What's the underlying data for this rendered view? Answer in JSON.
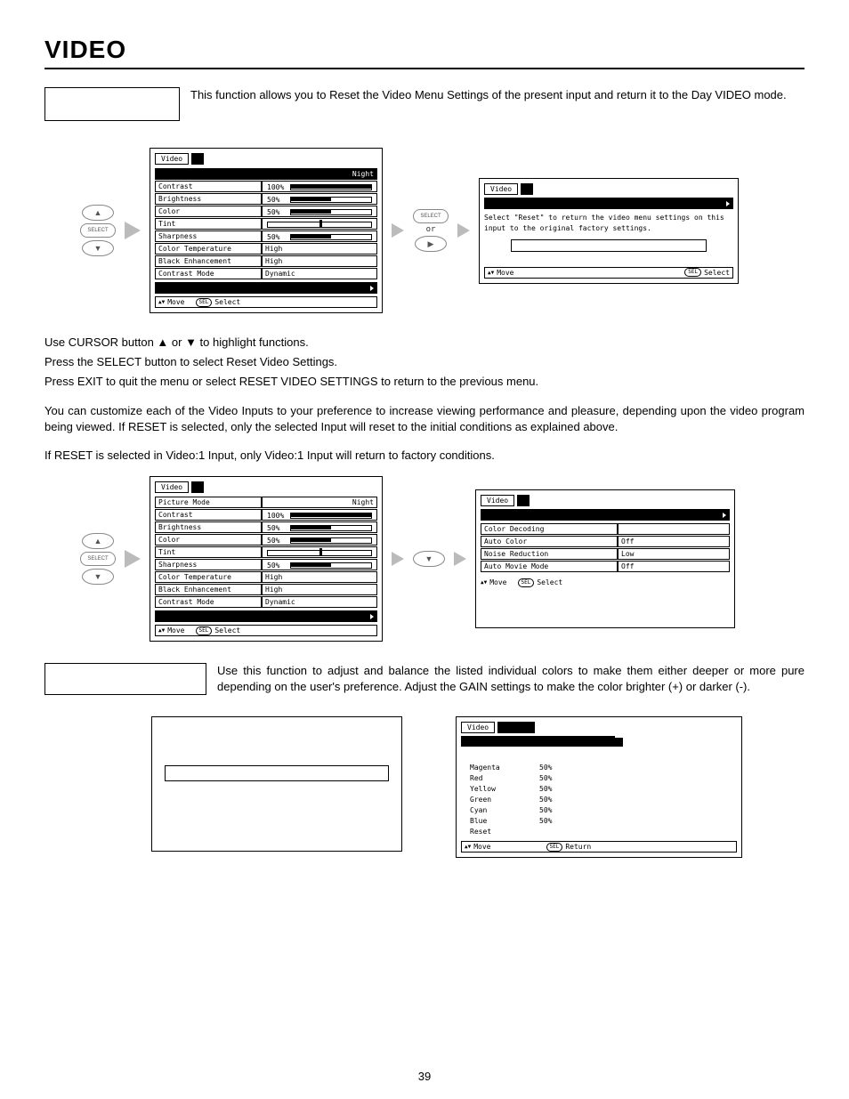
{
  "page": {
    "title": "VIDEO",
    "number": "39"
  },
  "section1": {
    "desc": "This function allows you to Reset the Video Menu Settings of the present input and return it to the Day VIDEO mode."
  },
  "osd_video_label": "Video",
  "remote": {
    "select_label": "SELECT"
  },
  "osd1": {
    "picture_mode_value": "Night",
    "rows": [
      {
        "name": "Contrast",
        "pct": "100%",
        "fill": 100
      },
      {
        "name": "Brightness",
        "pct": "50%",
        "fill": 50
      },
      {
        "name": "Color",
        "pct": "50%",
        "fill": 50
      },
      {
        "name": "Tint",
        "pct": "",
        "fill": 0,
        "knob": 50
      },
      {
        "name": "Sharpness",
        "pct": "50%",
        "fill": 50
      },
      {
        "name": "Color Temperature",
        "val": "High"
      },
      {
        "name": "Black Enhancement",
        "val": "High"
      },
      {
        "name": "Contrast Mode",
        "val": "Dynamic"
      }
    ],
    "footer_move": "Move",
    "footer_select": "Select"
  },
  "osd_reset": {
    "msg": "Select \"Reset\" to return the video menu settings on this input to the original factory settings.",
    "footer_move": "Move",
    "footer_select": "Select"
  },
  "mid_or": "or",
  "body": {
    "l1": "Use CURSOR button ▲ or ▼ to highlight functions.",
    "l2": "Press the SELECT button to select Reset Video Settings.",
    "l3": "Press EXIT to quit the menu or select RESET VIDEO SETTINGS to return to the previous menu.",
    "p2": "You can customize each of the Video Inputs to your preference to increase viewing performance and pleasure, depending upon the video program being viewed. If RESET is selected, only the selected Input will reset to the initial conditions as explained above.",
    "p3": "If RESET is selected in Video:1 Input, only Video:1 Input will return to factory conditions."
  },
  "osd2": {
    "picture_mode_label": "Picture Mode",
    "picture_mode_value": "Night",
    "rows": [
      {
        "name": "Contrast",
        "pct": "100%",
        "fill": 100
      },
      {
        "name": "Brightness",
        "pct": "50%",
        "fill": 50
      },
      {
        "name": "Color",
        "pct": "50%",
        "fill": 50
      },
      {
        "name": "Tint",
        "pct": "",
        "fill": 0,
        "knob": 50
      },
      {
        "name": "Sharpness",
        "pct": "50%",
        "fill": 50
      },
      {
        "name": "Color Temperature",
        "val": "High"
      },
      {
        "name": "Black Enhancement",
        "val": "High"
      },
      {
        "name": "Contrast Mode",
        "val": "Dynamic"
      }
    ],
    "footer_move": "Move",
    "footer_select": "Select"
  },
  "osd_colordec": {
    "title_row": "Color Decoding",
    "rows": [
      {
        "name": "Auto Color",
        "val": "Off"
      },
      {
        "name": "Noise Reduction",
        "val": "Low"
      },
      {
        "name": "Auto Movie Mode",
        "val": "Off"
      }
    ],
    "footer_move": "Move",
    "footer_select": "Select"
  },
  "section3": {
    "desc": "Use this function to adjust and balance the listed individual colors to make them either deeper or more pure depending on the user's preference. Adjust the GAIN settings to make the color brighter (+) or darker (-)."
  },
  "osd_cm": {
    "rows": [
      {
        "name": "Magenta",
        "val": "50%"
      },
      {
        "name": "Red",
        "val": "50%"
      },
      {
        "name": "Yellow",
        "val": "50%"
      },
      {
        "name": "Green",
        "val": "50%"
      },
      {
        "name": "Cyan",
        "val": "50%"
      },
      {
        "name": "Blue",
        "val": "50%"
      },
      {
        "name": "Reset",
        "val": ""
      }
    ],
    "footer_move": "Move",
    "footer_return": "Return"
  }
}
